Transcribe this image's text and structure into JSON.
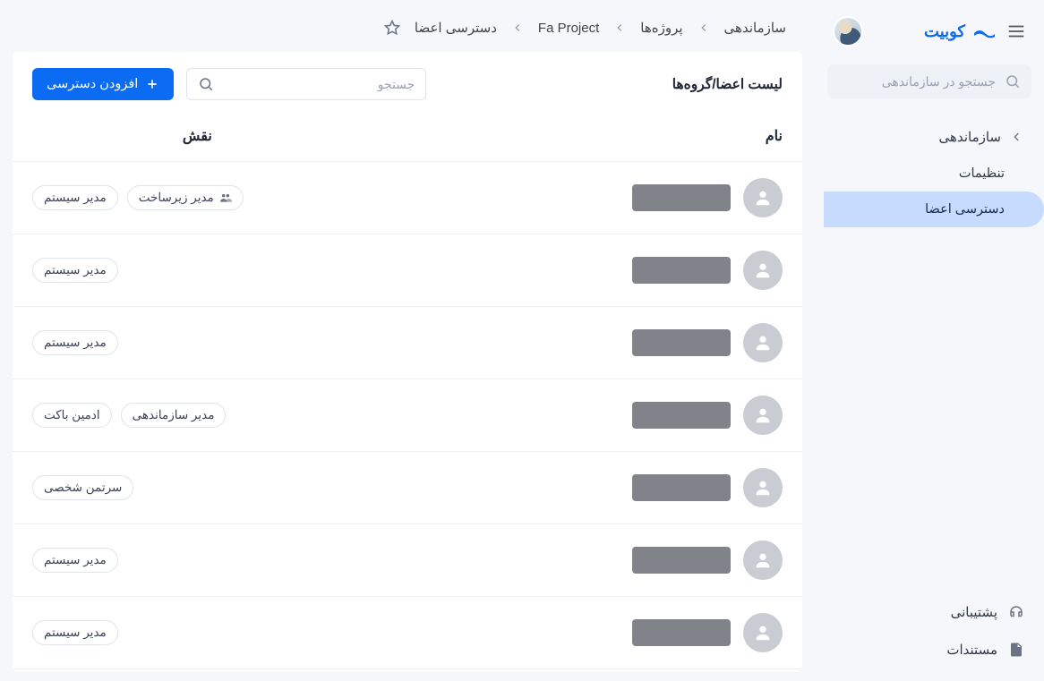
{
  "brand": {
    "name": "کوبیت"
  },
  "sidebar": {
    "search_placeholder": "جستجو در سازماندهی",
    "items": [
      {
        "label": "سازماندهی",
        "has_arrow": true
      },
      {
        "label": "تنظیمات"
      },
      {
        "label": "دسترسی اعضا",
        "active": true
      }
    ],
    "bottom": [
      {
        "label": "پشتیبانی",
        "icon": "support-icon"
      },
      {
        "label": "مستندات",
        "icon": "docs-icon"
      }
    ]
  },
  "breadcrumbs": [
    {
      "label": "سازماندهی"
    },
    {
      "label": "پروژه‌ها"
    },
    {
      "label": "Fa Project"
    },
    {
      "label": "دسترسی اعضا"
    }
  ],
  "panel": {
    "title": "لیست اعضا/گروه‌ها",
    "search_placeholder": "جستجو",
    "add_label": "افزودن دسترسی",
    "columns": {
      "name": "نام",
      "role": "نقش"
    },
    "rows": [
      {
        "roles": [
          {
            "label": "مدیر زیرساخت",
            "icon": true
          },
          {
            "label": "مدیر سیستم"
          }
        ]
      },
      {
        "roles": [
          {
            "label": "مدیر سیستم"
          }
        ]
      },
      {
        "roles": [
          {
            "label": "مدیر سیستم"
          }
        ]
      },
      {
        "roles": [
          {
            "label": "مدیر سازماندهی"
          },
          {
            "label": "ادمین باکت"
          }
        ]
      },
      {
        "roles": [
          {
            "label": "سرتمن شخصی"
          }
        ]
      },
      {
        "roles": [
          {
            "label": "مدیر سیستم"
          }
        ]
      },
      {
        "roles": [
          {
            "label": "مدیر سیستم"
          }
        ]
      }
    ]
  }
}
